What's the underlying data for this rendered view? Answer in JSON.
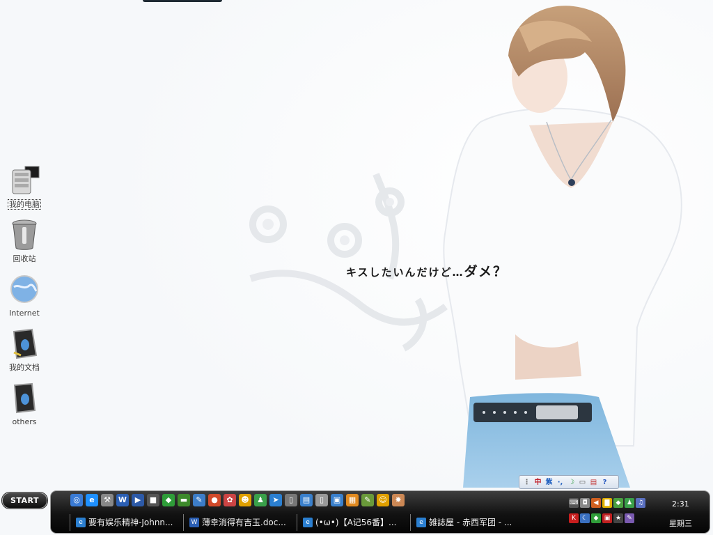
{
  "desktop": {
    "icons": [
      {
        "label": "我的电脑"
      },
      {
        "label": "回收站"
      },
      {
        "label": "Internet"
      },
      {
        "label": "我的文档"
      },
      {
        "label": "others"
      }
    ]
  },
  "wallpaper": {
    "caption": "キスしたいんだけど…",
    "caption_emphasis": "ダメ？"
  },
  "taskbar": {
    "start_label": "START",
    "quick_launch": [
      {
        "icon": "show-desktop-icon",
        "glyph": "◎",
        "color": "#3a7bd5"
      },
      {
        "icon": "ie-icon",
        "glyph": "e",
        "color": "#1e90ff"
      },
      {
        "icon": "tool-icon",
        "glyph": "⚒",
        "color": "#888888"
      },
      {
        "icon": "word-icon",
        "glyph": "W",
        "color": "#2b5fb4"
      },
      {
        "icon": "media-player-icon",
        "glyph": "▶",
        "color": "#2d5aa8"
      },
      {
        "icon": "camera-icon",
        "glyph": "■",
        "color": "#555555"
      },
      {
        "icon": "shield-icon",
        "glyph": "◆",
        "color": "#2f9d39"
      },
      {
        "icon": "nvidia-icon",
        "glyph": "▬",
        "color": "#3d8a2b"
      },
      {
        "icon": "pen-icon",
        "glyph": "✎",
        "color": "#3d7dc8"
      },
      {
        "icon": "chrome-icon",
        "glyph": "●",
        "color": "#d14a2a"
      },
      {
        "icon": "paint-icon",
        "glyph": "✿",
        "color": "#c44"
      },
      {
        "icon": "qq-icon",
        "glyph": "☻",
        "color": "#e0a000"
      },
      {
        "icon": "msn-icon",
        "glyph": "♟",
        "color": "#3aa04a"
      },
      {
        "icon": "arrow-icon",
        "glyph": "➤",
        "color": "#2b7fd0"
      },
      {
        "icon": "phone-icon",
        "glyph": "▯",
        "color": "#777777"
      },
      {
        "icon": "document-icon",
        "glyph": "▤",
        "color": "#3a80cc"
      },
      {
        "icon": "ipod-icon",
        "glyph": "▯",
        "color": "#999999"
      },
      {
        "icon": "monitor-icon",
        "glyph": "▣",
        "color": "#3a80cc"
      },
      {
        "icon": "package-icon",
        "glyph": "▦",
        "color": "#e08a20"
      },
      {
        "icon": "notepad-icon",
        "glyph": "✎",
        "color": "#6a9a3a"
      },
      {
        "icon": "smiley-icon",
        "glyph": "☺",
        "color": "#e0a000"
      },
      {
        "icon": "palette-icon",
        "glyph": "✸",
        "color": "#c85"
      }
    ],
    "tasks": [
      {
        "label": "要有娱乐精神-Johnn...",
        "icon": "ie-icon",
        "glyph": "e",
        "color": "#2b7fd0"
      },
      {
        "label": "薄幸消得有吉玉.doc...",
        "icon": "word-icon",
        "glyph": "W",
        "color": "#2b5fb4"
      },
      {
        "label": "(•ω•)【A记56番】...",
        "icon": "ie-icon",
        "glyph": "e",
        "color": "#2b7fd0"
      },
      {
        "label": "雑誌屋 - 赤西军团 - ...",
        "icon": "ie-icon",
        "glyph": "e",
        "color": "#2b7fd0"
      }
    ],
    "tray_row1": [
      {
        "icon": "keyboard-icon",
        "glyph": "⌨",
        "color": "#555"
      },
      {
        "icon": "usb-icon",
        "glyph": "◘",
        "color": "#888"
      },
      {
        "icon": "volume-icon",
        "glyph": "◀",
        "color": "#d06020"
      },
      {
        "icon": "folder-icon",
        "glyph": "▇",
        "color": "#e0b000"
      },
      {
        "icon": "cube-icon",
        "glyph": "◆",
        "color": "#4aa040"
      },
      {
        "icon": "msn-icon",
        "glyph": "♟",
        "color": "#3aa04a"
      },
      {
        "icon": "music-icon",
        "glyph": "♫",
        "color": "#5a70c0"
      }
    ],
    "tray_row2": [
      {
        "icon": "antivirus-icon",
        "glyph": "K",
        "color": "#c81e1e"
      },
      {
        "icon": "network-icon",
        "glyph": "☾",
        "color": "#3a70c0"
      },
      {
        "icon": "shield-icon",
        "glyph": "◆",
        "color": "#2f9d39"
      },
      {
        "icon": "flash-icon",
        "glyph": "▣",
        "color": "#c02020"
      },
      {
        "icon": "star-icon",
        "glyph": "★",
        "color": "#444"
      },
      {
        "icon": "paint-icon",
        "glyph": "✎",
        "color": "#7a5ab0"
      }
    ],
    "clock": "2:31",
    "weekday": "星期三"
  },
  "language_bar": {
    "items": [
      {
        "icon": "grip-icon",
        "glyph": "⋮",
        "color": "#666"
      },
      {
        "icon": "ime-chinese-icon",
        "glyph": "中",
        "color": "#c0202a"
      },
      {
        "icon": "ime-mode-icon",
        "glyph": "紫",
        "color": "#1f5fbf"
      },
      {
        "icon": "punctuation-icon",
        "glyph": "·,",
        "color": "#1f5fbf"
      },
      {
        "icon": "moon-icon",
        "glyph": "☽",
        "color": "#2a9a3a"
      },
      {
        "icon": "soft-keyboard-icon",
        "glyph": "▭",
        "color": "#555"
      },
      {
        "icon": "menu-icon",
        "glyph": "▤",
        "color": "#c03030"
      },
      {
        "icon": "help-icon",
        "glyph": "?",
        "color": "#2a5ac0"
      }
    ]
  }
}
